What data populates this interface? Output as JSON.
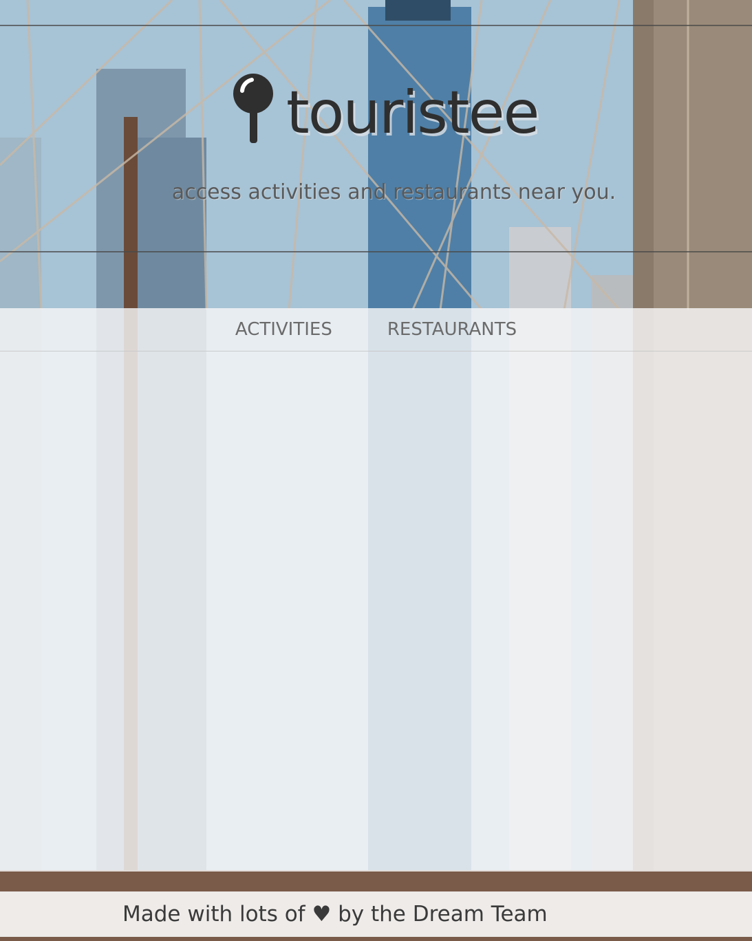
{
  "header": {
    "brand": "touristee",
    "tagline": "access activities and restaurants near you.",
    "logo_icon": "map-pin-icon"
  },
  "nav": {
    "items": [
      {
        "label": "ACTIVITIES"
      },
      {
        "label": "RESTAURANTS"
      }
    ]
  },
  "footer": {
    "prefix": "Made with lots of",
    "heart": "♥",
    "suffix": "by the Dream Team"
  },
  "colors": {
    "brand_text": "#2f2f2f",
    "nav_text": "#6b6b6b",
    "overlay": "#f6f6f6"
  }
}
